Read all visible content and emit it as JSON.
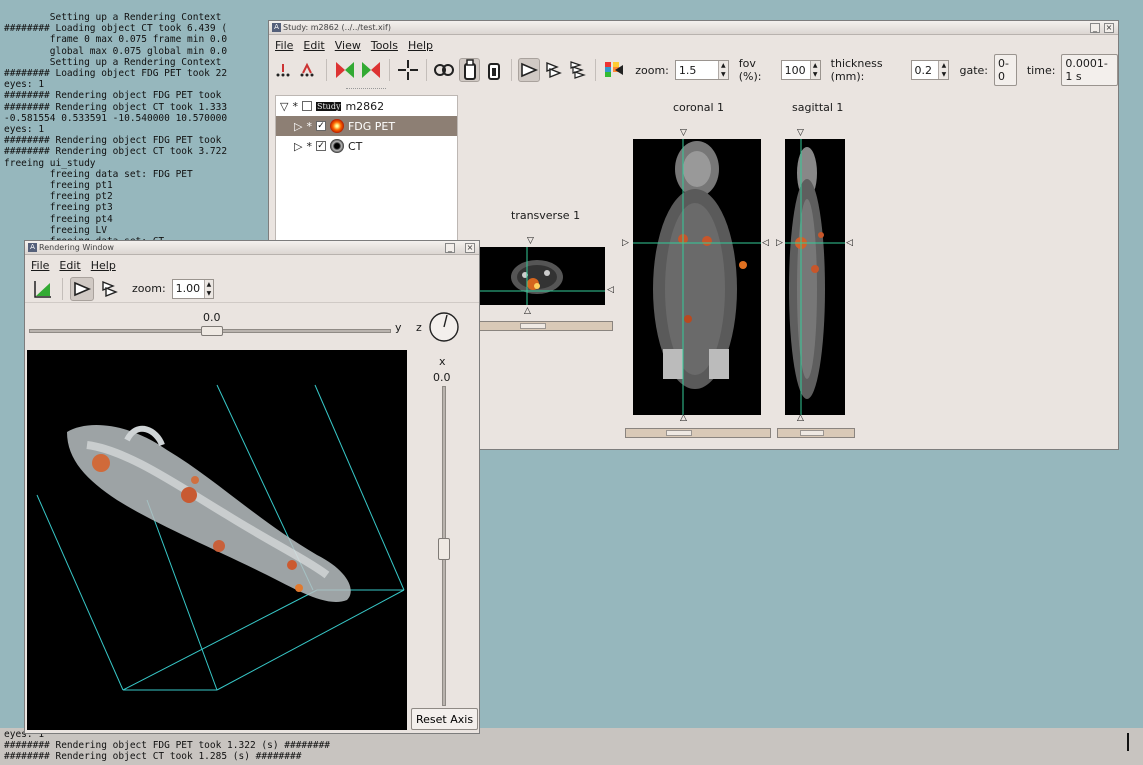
{
  "terminal": {
    "lines": [
      "        Setting up a Rendering Context",
      "######## Loading object CT took 6.439 (",
      "        frame 0 max 0.075 frame min 0.0",
      "        global max 0.075 global min 0.0",
      "        Setting up a Rendering Context",
      "######## Loading object FDG PET took 22",
      "eyes: 1",
      "######## Rendering object FDG PET took",
      "######## Rendering object CT took 1.333",
      "-0.581554 0.533591 -10.540000 10.570000",
      "eyes: 1",
      "######## Rendering object FDG PET took",
      "######## Rendering object CT took 3.722",
      "freeing ui_study",
      "        freeing data set: FDG PET",
      "        freeing pt1",
      "        freeing pt2",
      "        freeing pt3",
      "        freeing pt4",
      "        freeing LV",
      "        freeing data set: CT"
    ],
    "bottom_lines": [
      "eyes: 1",
      "######## Rendering object FDG PET took 1.322 (s) ########",
      "######## Rendering object CT took 1.285 (s) ########"
    ]
  },
  "study_window": {
    "title": "Study: m2862 (../../test.xif)",
    "menu": [
      "File",
      "Edit",
      "View",
      "Tools",
      "Help"
    ],
    "zoom_label": "zoom:",
    "zoom_value": "1.5",
    "fov_label": "fov (%):",
    "fov_value": "100",
    "thickness_label": "thickness (mm):",
    "thickness_value": "0.2",
    "gate_label": "gate:",
    "gate_value": "0-0",
    "time_label": "time:",
    "time_value": "0.0001-1 s",
    "tree": {
      "study_label": "m2862",
      "study_badge": "Study",
      "items": [
        {
          "label": "FDG PET",
          "checked": true,
          "selected": true
        },
        {
          "label": "CT",
          "checked": true,
          "selected": false
        }
      ]
    },
    "views": {
      "transverse": "transverse 1",
      "coronal": "coronal 1",
      "sagittal": "sagittal 1"
    }
  },
  "render_window": {
    "title": "Rendering Window",
    "menu": [
      "File",
      "Edit",
      "Help"
    ],
    "zoom_label": "zoom:",
    "zoom_value": "1.00",
    "y_value": "0.0",
    "y_label": "y",
    "z_label": "z",
    "x_label": "x",
    "x_value": "0.0",
    "reset_axis": "Reset Axis"
  }
}
